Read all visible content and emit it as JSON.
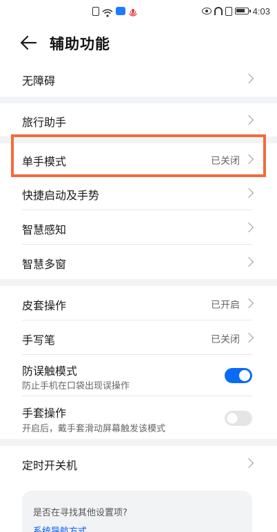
{
  "status_bar": {
    "time": "4:03",
    "left_icons": [
      "sim-card-icon",
      "wifi-icon",
      "cloud-icon",
      "huawei-logo-icon"
    ],
    "right_icons": [
      "eye-icon",
      "headphones-icon",
      "vibrate-icon",
      "battery-icon"
    ]
  },
  "header": {
    "back_icon": "arrow-left-icon",
    "title": "辅助功能"
  },
  "groups": [
    {
      "rows": [
        {
          "label": "无障碍",
          "value": ""
        }
      ]
    },
    {
      "rows": [
        {
          "label": "旅行助手",
          "value": ""
        },
        {
          "label": "单手模式",
          "value": "已关闭",
          "highlighted": true
        },
        {
          "label": "快捷启动及手势",
          "value": ""
        },
        {
          "label": "智慧感知",
          "value": ""
        },
        {
          "label": "智慧多窗",
          "value": ""
        }
      ]
    },
    {
      "rows": [
        {
          "label": "皮套操作",
          "value": "已开启"
        },
        {
          "label": "手写笔",
          "value": "已关闭"
        },
        {
          "label": "防误触模式",
          "sublabel": "防止手机在口袋出现误操作",
          "toggle": true,
          "toggle_on": true
        },
        {
          "label": "手套操作",
          "sublabel": "开启后，戴手套滑动屏幕触发该模式",
          "toggle": true,
          "toggle_on": false
        }
      ]
    },
    {
      "rows": [
        {
          "label": "定时开关机",
          "value": ""
        }
      ]
    }
  ],
  "suggestion": {
    "question": "是否在寻找其他设置项?",
    "link": "系统导航方式"
  },
  "colors": {
    "accent": "#0a6cf5",
    "highlight_border": "#f26b3a",
    "link": "#0a59f7",
    "band": "#f1f3f5"
  }
}
